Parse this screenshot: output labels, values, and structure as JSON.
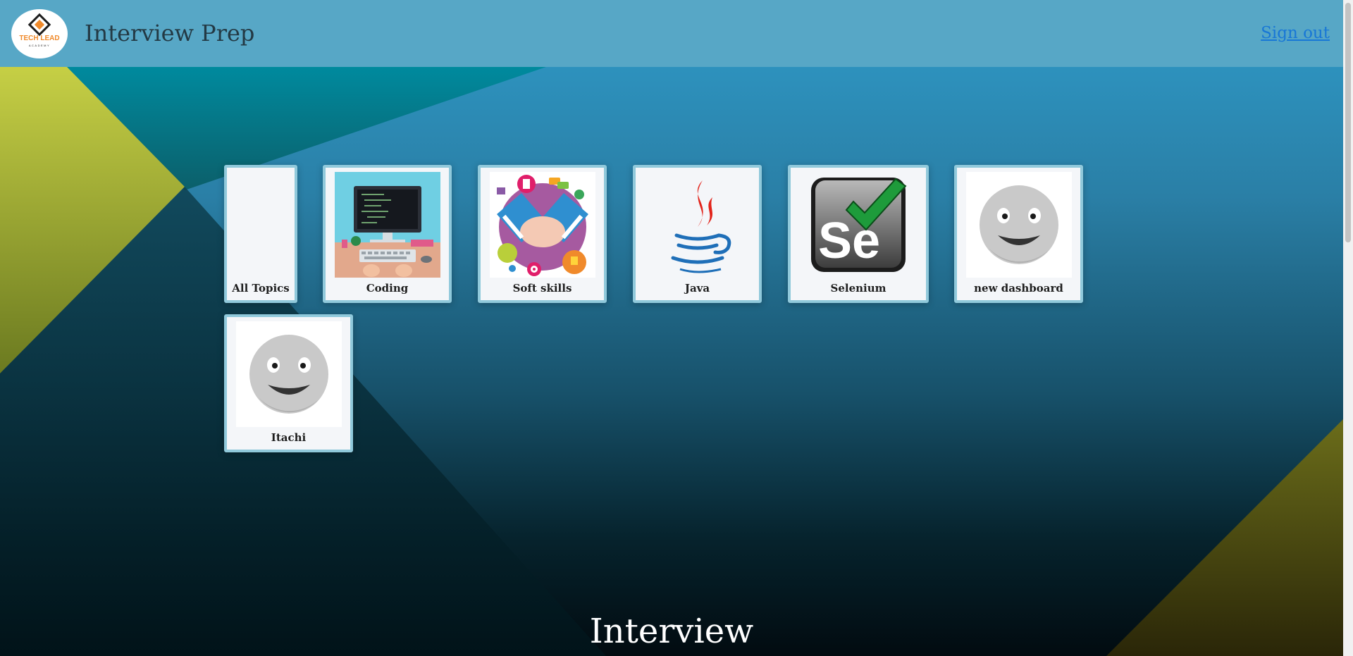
{
  "header": {
    "logo_text": "TECH LEAD",
    "logo_subtext": "ACADEMY",
    "title": "Interview Prep",
    "signout_label": "Sign out"
  },
  "topics": [
    {
      "label": "All Topics",
      "icon": "none"
    },
    {
      "label": "Coding",
      "icon": "computer-desk-icon"
    },
    {
      "label": "Soft skills",
      "icon": "handshake-icon"
    },
    {
      "label": "Java",
      "icon": "java-logo-icon"
    },
    {
      "label": "Selenium",
      "icon": "selenium-logo-icon"
    },
    {
      "label": "new dashboard",
      "icon": "smiley-face-icon"
    },
    {
      "label": "Itachi",
      "icon": "smiley-face-icon"
    }
  ],
  "footer": {
    "heading": "Interview"
  },
  "colors": {
    "header_bg": "#57a7c6",
    "card_border": "#90c9db",
    "link": "#1877d6",
    "accent_yellow": "#c2cc40"
  }
}
